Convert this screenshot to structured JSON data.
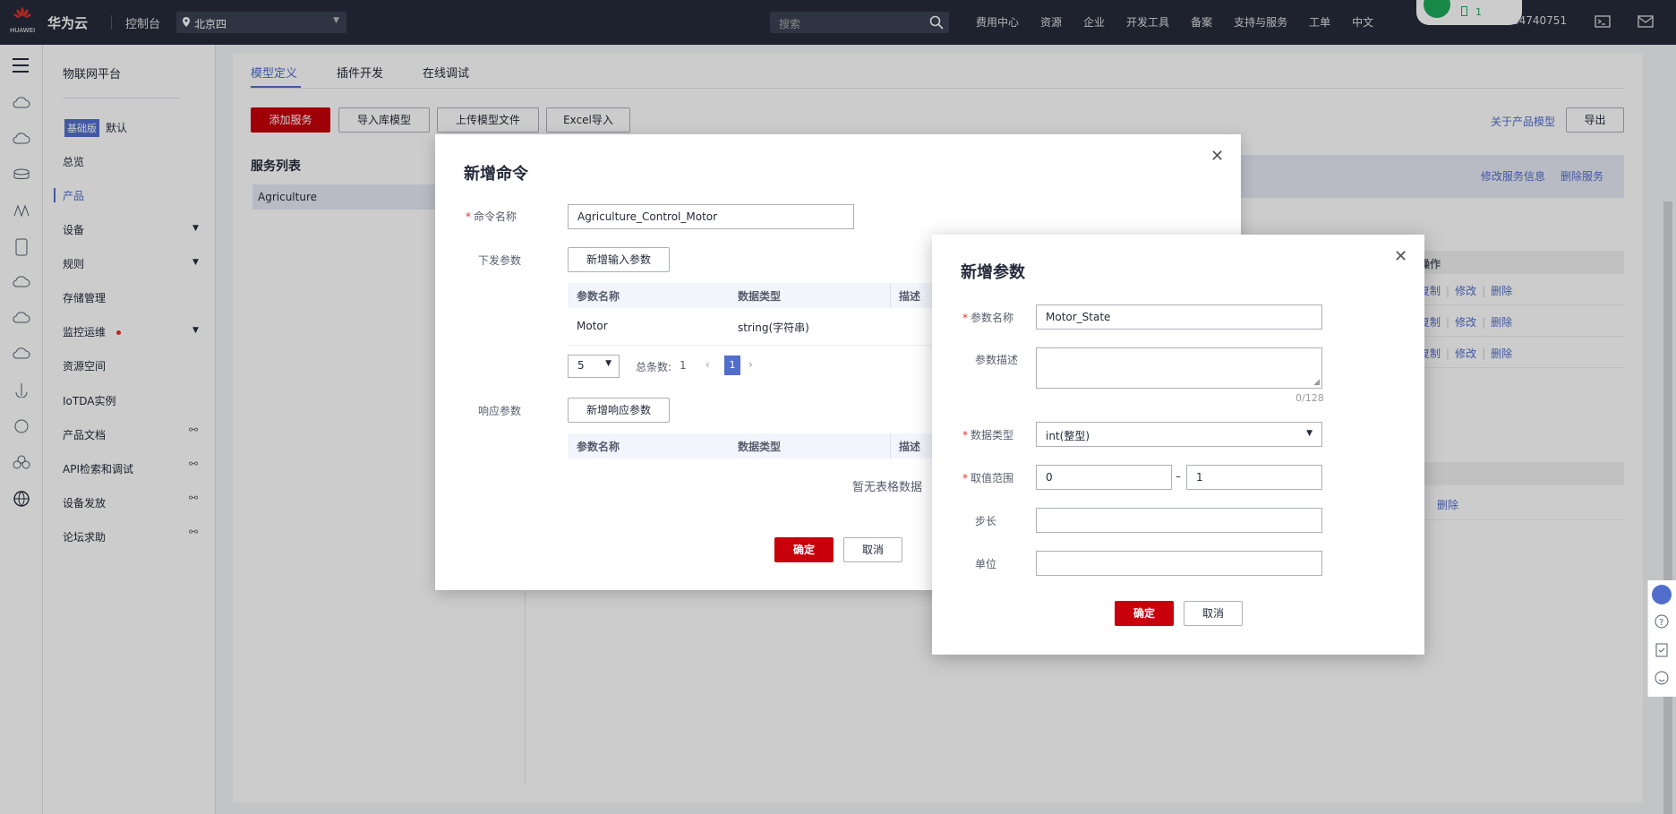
{
  "topbar": {
    "brand": "华为云",
    "logo_text": "HUAWEI",
    "console": "控制台",
    "region": "北京四",
    "search_placeholder": "搜索",
    "nav": [
      "费用中心",
      "资源",
      "企业",
      "开发工具",
      "备案",
      "支持与服务",
      "工单",
      "中文"
    ],
    "user_id": "84740751",
    "wifi_count": "1"
  },
  "sidebar": {
    "title": "物联网平台",
    "edition_badge": "基础版",
    "edition_label": "默认",
    "items": [
      {
        "label": "总览"
      },
      {
        "label": "产品"
      },
      {
        "label": "设备"
      },
      {
        "label": "规则"
      },
      {
        "label": "存储管理"
      },
      {
        "label": "监控运维"
      },
      {
        "label": "资源空间"
      },
      {
        "label": "IoTDA实例"
      },
      {
        "label": "产品文档"
      },
      {
        "label": "API检索和调试"
      },
      {
        "label": "设备发放"
      },
      {
        "label": "论坛求助"
      }
    ]
  },
  "main": {
    "tabs": [
      "模型定义",
      "插件开发",
      "在线调试"
    ],
    "toolbar": {
      "add_service": "添加服务",
      "import_lib": "导入库模型",
      "upload_model": "上传模型文件",
      "excel_import": "Excel导入",
      "about_model": "关于产品模型",
      "export": "导出"
    },
    "service_list_title": "服务列表",
    "service_item": "Agriculture",
    "service_links": {
      "edit": "修改服务信息",
      "delete": "删除服务"
    },
    "ops_header": "操作",
    "row_ops": {
      "copy": "复制",
      "edit": "修改",
      "delete": "删除"
    }
  },
  "dialog_command": {
    "title": "新增命令",
    "name_label": "命令名称",
    "name_value": "Agriculture_Control_Motor",
    "down_params_label": "下发参数",
    "add_input_btn": "新增输入参数",
    "col_name": "参数名称",
    "col_type": "数据类型",
    "col_desc": "描述",
    "row": {
      "name": "Motor",
      "type": "string(字符串)"
    },
    "page_size": "5",
    "total_label": "总条数:",
    "total_value": "1",
    "page": "1",
    "resp_params_label": "响应参数",
    "add_resp_btn": "新增响应参数",
    "empty_text": "暂无表格数据",
    "ok": "确定",
    "cancel": "取消"
  },
  "dialog_param": {
    "title": "新增参数",
    "name_label": "参数名称",
    "name_value": "Motor_State",
    "desc_label": "参数描述",
    "desc_count": "0/128",
    "type_label": "数据类型",
    "type_value": "int(整型)",
    "range_label": "取值范围",
    "range_min": "0",
    "range_dash": "–",
    "range_max": "1",
    "step_label": "步长",
    "unit_label": "单位",
    "ok": "确定",
    "cancel": "取消"
  },
  "colors": {
    "primary": "#c7000b",
    "accent": "#526ecc",
    "topbar": "#252b3a"
  }
}
